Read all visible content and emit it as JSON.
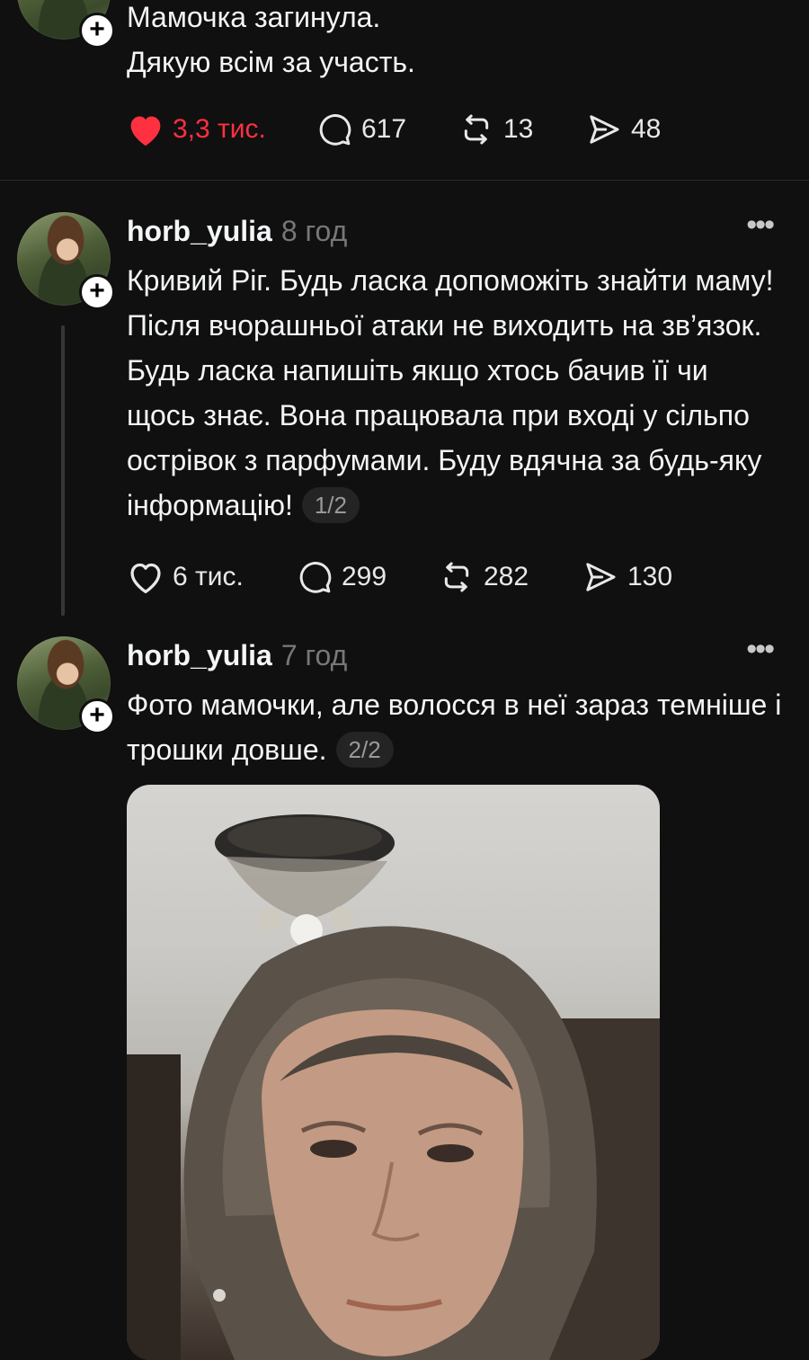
{
  "posts": [
    {
      "text_lines": [
        "Мамочка загинула.",
        "Дякую всім за участь."
      ],
      "actions": {
        "likes": "3,3 тис.",
        "comments": "617",
        "reposts": "13",
        "shares": "48"
      },
      "liked": true
    },
    {
      "username": "horb_yulia",
      "time": "8 год",
      "text": "Кривий Ріг. Будь ласка допоможіть знайти маму! Після вчорашньої атаки не виходить на зв’язок. Будь ласка напишіть якщо хтось бачив її чи щось знає. Вона працювала при вході у сільпо острівок з парфумами. Буду вдячна за будь-яку інформацію!",
      "pager": "1/2",
      "actions": {
        "likes": "6 тис.",
        "comments": "299",
        "reposts": "282",
        "shares": "130"
      },
      "liked": false
    },
    {
      "username": "horb_yulia",
      "time": "7 год",
      "text": "Фото мамочки, але волосся в неї зараз темніше і трошки довше.",
      "pager": "2/2",
      "has_photo": true
    }
  ],
  "colors": {
    "background": "#101010",
    "like_red": "#ff3040",
    "muted": "#777777"
  },
  "icons": [
    "heart-icon",
    "comment-icon",
    "repost-icon",
    "share-icon",
    "more-icon",
    "follow-plus-icon"
  ]
}
